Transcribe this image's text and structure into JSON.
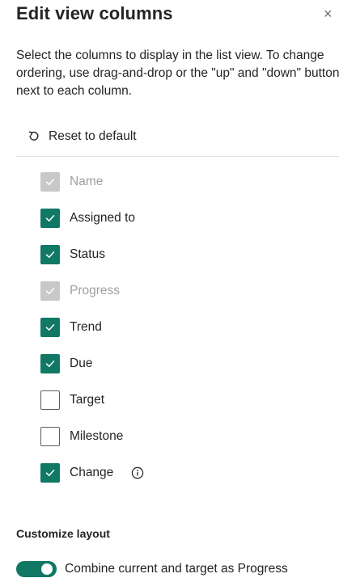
{
  "panel": {
    "title": "Edit view columns",
    "close_glyph": "×",
    "description": "Select the columns to display in the list view. To change ordering, use drag-and-drop or the \"up\" and \"down\" buttons next to each column."
  },
  "reset": {
    "label": "Reset to default",
    "icon": "reset-icon"
  },
  "columns": [
    {
      "label": "Name",
      "checked": true,
      "disabled": true
    },
    {
      "label": "Assigned to",
      "checked": true,
      "disabled": false
    },
    {
      "label": "Status",
      "checked": true,
      "disabled": false
    },
    {
      "label": "Progress",
      "checked": true,
      "disabled": true
    },
    {
      "label": "Trend",
      "checked": true,
      "disabled": false
    },
    {
      "label": "Due",
      "checked": true,
      "disabled": false
    },
    {
      "label": "Target",
      "checked": false,
      "disabled": false
    },
    {
      "label": "Milestone",
      "checked": false,
      "disabled": false
    },
    {
      "label": "Change",
      "checked": true,
      "disabled": false,
      "info": true
    }
  ],
  "layout": {
    "section_title": "Customize layout",
    "toggle_label": "Combine current and target as Progress",
    "toggle_on": true
  },
  "colors": {
    "accent": "#117865",
    "disabled_box": "#c8c8c8",
    "disabled_text": "#a19f9d"
  }
}
